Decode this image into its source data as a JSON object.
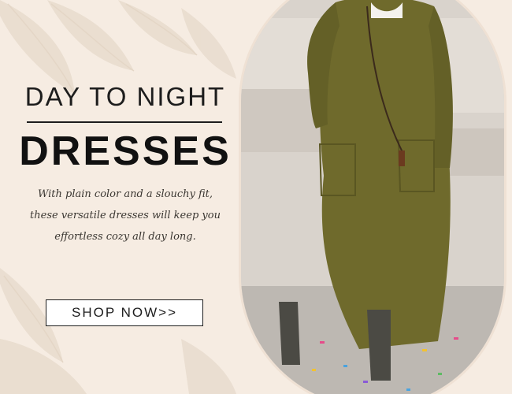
{
  "banner": {
    "title_line1": "DAY TO NIGHT",
    "title_line2": "DRESSES",
    "description": [
      "With plain color and a slouchy fit,",
      "these versatile dresses will keep you",
      "effortless cozy all day long."
    ],
    "cta_label": "SHOP NOW>>"
  },
  "colors": {
    "background": "#f6ece2",
    "text": "#1d1d1d",
    "dress": "#6f6a2c",
    "wall": "#dcd6cf"
  },
  "icons": {
    "photo": "model-in-olive-sweater-dress-image",
    "leaves": "botanical-leaves-decoration"
  }
}
